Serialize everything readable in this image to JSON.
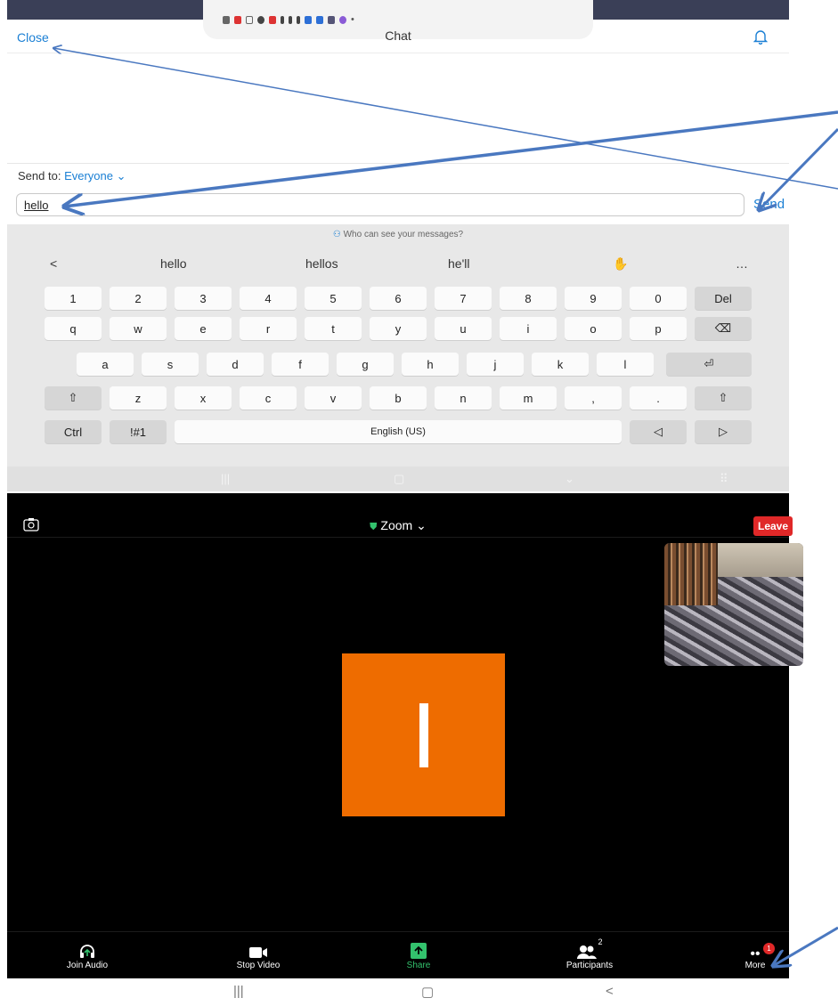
{
  "chat": {
    "close_label": "Close",
    "title": "Chat",
    "send_to_label": "Send to:",
    "send_to_value": "Everyone",
    "input_value": "hello",
    "send_label": "Send",
    "privacy_note": "Who can see your messages?"
  },
  "keyboard": {
    "suggestions": [
      "hello",
      "hellos",
      "he'll"
    ],
    "more_glyph": "…",
    "back_glyph": "<",
    "row1": [
      "1",
      "2",
      "3",
      "4",
      "5",
      "6",
      "7",
      "8",
      "9",
      "0",
      "Del"
    ],
    "row2": [
      "q",
      "w",
      "e",
      "r",
      "t",
      "y",
      "u",
      "i",
      "o",
      "p"
    ],
    "row3": [
      "a",
      "s",
      "d",
      "f",
      "g",
      "h",
      "j",
      "k",
      "l"
    ],
    "row4": [
      "z",
      "x",
      "c",
      "v",
      "b",
      "n",
      "m",
      ",",
      "."
    ],
    "ctrl": "Ctrl",
    "symbols": "!#1",
    "space": "English (US)"
  },
  "meeting": {
    "title": "Zoom",
    "leave_label": "Leave",
    "avatar_initial": "I",
    "toolbar": {
      "join_audio": "Join Audio",
      "stop_video": "Stop Video",
      "share": "Share",
      "participants": "Participants",
      "participants_count": "2",
      "more": "More",
      "more_badge": "1"
    }
  },
  "colors": {
    "link": "#1a7fd4",
    "leave": "#e02828",
    "share": "#33c26d",
    "avatar": "#ee6c00",
    "annotation": "#4a78c0"
  },
  "icons": [
    "notification-icons",
    "bell-icon",
    "contacts-icon",
    "wave-emoji-icon",
    "camera-switch-icon",
    "shield-icon",
    "headphones-icon",
    "video-icon",
    "share-icon",
    "participants-icon",
    "more-icon"
  ]
}
